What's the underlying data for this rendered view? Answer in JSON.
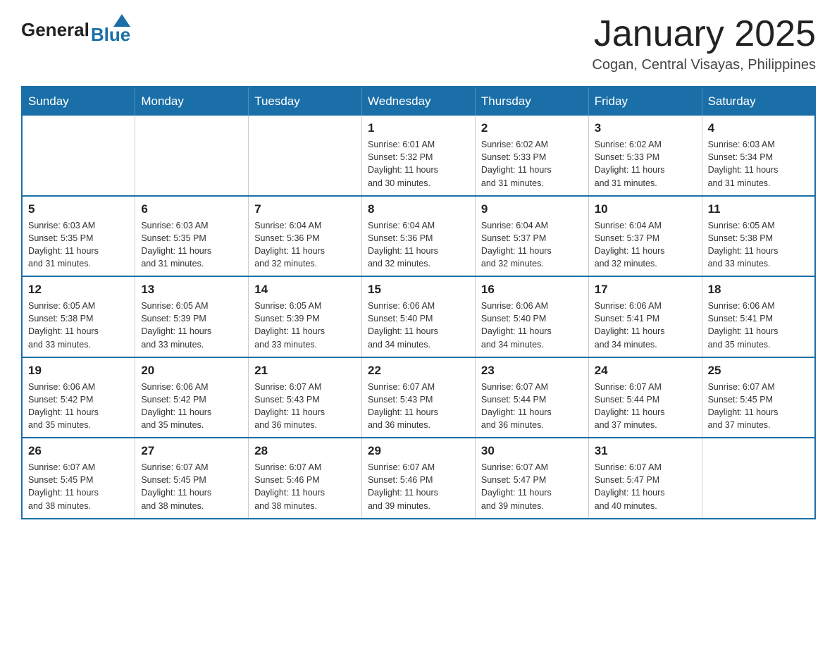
{
  "header": {
    "logo": {
      "general": "General",
      "blue": "Blue"
    },
    "title": "January 2025",
    "location": "Cogan, Central Visayas, Philippines"
  },
  "days_of_week": [
    "Sunday",
    "Monday",
    "Tuesday",
    "Wednesday",
    "Thursday",
    "Friday",
    "Saturday"
  ],
  "weeks": [
    {
      "days": [
        {
          "num": "",
          "info": ""
        },
        {
          "num": "",
          "info": ""
        },
        {
          "num": "",
          "info": ""
        },
        {
          "num": "1",
          "info": "Sunrise: 6:01 AM\nSunset: 5:32 PM\nDaylight: 11 hours\nand 30 minutes."
        },
        {
          "num": "2",
          "info": "Sunrise: 6:02 AM\nSunset: 5:33 PM\nDaylight: 11 hours\nand 31 minutes."
        },
        {
          "num": "3",
          "info": "Sunrise: 6:02 AM\nSunset: 5:33 PM\nDaylight: 11 hours\nand 31 minutes."
        },
        {
          "num": "4",
          "info": "Sunrise: 6:03 AM\nSunset: 5:34 PM\nDaylight: 11 hours\nand 31 minutes."
        }
      ]
    },
    {
      "days": [
        {
          "num": "5",
          "info": "Sunrise: 6:03 AM\nSunset: 5:35 PM\nDaylight: 11 hours\nand 31 minutes."
        },
        {
          "num": "6",
          "info": "Sunrise: 6:03 AM\nSunset: 5:35 PM\nDaylight: 11 hours\nand 31 minutes."
        },
        {
          "num": "7",
          "info": "Sunrise: 6:04 AM\nSunset: 5:36 PM\nDaylight: 11 hours\nand 32 minutes."
        },
        {
          "num": "8",
          "info": "Sunrise: 6:04 AM\nSunset: 5:36 PM\nDaylight: 11 hours\nand 32 minutes."
        },
        {
          "num": "9",
          "info": "Sunrise: 6:04 AM\nSunset: 5:37 PM\nDaylight: 11 hours\nand 32 minutes."
        },
        {
          "num": "10",
          "info": "Sunrise: 6:04 AM\nSunset: 5:37 PM\nDaylight: 11 hours\nand 32 minutes."
        },
        {
          "num": "11",
          "info": "Sunrise: 6:05 AM\nSunset: 5:38 PM\nDaylight: 11 hours\nand 33 minutes."
        }
      ]
    },
    {
      "days": [
        {
          "num": "12",
          "info": "Sunrise: 6:05 AM\nSunset: 5:38 PM\nDaylight: 11 hours\nand 33 minutes."
        },
        {
          "num": "13",
          "info": "Sunrise: 6:05 AM\nSunset: 5:39 PM\nDaylight: 11 hours\nand 33 minutes."
        },
        {
          "num": "14",
          "info": "Sunrise: 6:05 AM\nSunset: 5:39 PM\nDaylight: 11 hours\nand 33 minutes."
        },
        {
          "num": "15",
          "info": "Sunrise: 6:06 AM\nSunset: 5:40 PM\nDaylight: 11 hours\nand 34 minutes."
        },
        {
          "num": "16",
          "info": "Sunrise: 6:06 AM\nSunset: 5:40 PM\nDaylight: 11 hours\nand 34 minutes."
        },
        {
          "num": "17",
          "info": "Sunrise: 6:06 AM\nSunset: 5:41 PM\nDaylight: 11 hours\nand 34 minutes."
        },
        {
          "num": "18",
          "info": "Sunrise: 6:06 AM\nSunset: 5:41 PM\nDaylight: 11 hours\nand 35 minutes."
        }
      ]
    },
    {
      "days": [
        {
          "num": "19",
          "info": "Sunrise: 6:06 AM\nSunset: 5:42 PM\nDaylight: 11 hours\nand 35 minutes."
        },
        {
          "num": "20",
          "info": "Sunrise: 6:06 AM\nSunset: 5:42 PM\nDaylight: 11 hours\nand 35 minutes."
        },
        {
          "num": "21",
          "info": "Sunrise: 6:07 AM\nSunset: 5:43 PM\nDaylight: 11 hours\nand 36 minutes."
        },
        {
          "num": "22",
          "info": "Sunrise: 6:07 AM\nSunset: 5:43 PM\nDaylight: 11 hours\nand 36 minutes."
        },
        {
          "num": "23",
          "info": "Sunrise: 6:07 AM\nSunset: 5:44 PM\nDaylight: 11 hours\nand 36 minutes."
        },
        {
          "num": "24",
          "info": "Sunrise: 6:07 AM\nSunset: 5:44 PM\nDaylight: 11 hours\nand 37 minutes."
        },
        {
          "num": "25",
          "info": "Sunrise: 6:07 AM\nSunset: 5:45 PM\nDaylight: 11 hours\nand 37 minutes."
        }
      ]
    },
    {
      "days": [
        {
          "num": "26",
          "info": "Sunrise: 6:07 AM\nSunset: 5:45 PM\nDaylight: 11 hours\nand 38 minutes."
        },
        {
          "num": "27",
          "info": "Sunrise: 6:07 AM\nSunset: 5:45 PM\nDaylight: 11 hours\nand 38 minutes."
        },
        {
          "num": "28",
          "info": "Sunrise: 6:07 AM\nSunset: 5:46 PM\nDaylight: 11 hours\nand 38 minutes."
        },
        {
          "num": "29",
          "info": "Sunrise: 6:07 AM\nSunset: 5:46 PM\nDaylight: 11 hours\nand 39 minutes."
        },
        {
          "num": "30",
          "info": "Sunrise: 6:07 AM\nSunset: 5:47 PM\nDaylight: 11 hours\nand 39 minutes."
        },
        {
          "num": "31",
          "info": "Sunrise: 6:07 AM\nSunset: 5:47 PM\nDaylight: 11 hours\nand 40 minutes."
        },
        {
          "num": "",
          "info": ""
        }
      ]
    }
  ]
}
